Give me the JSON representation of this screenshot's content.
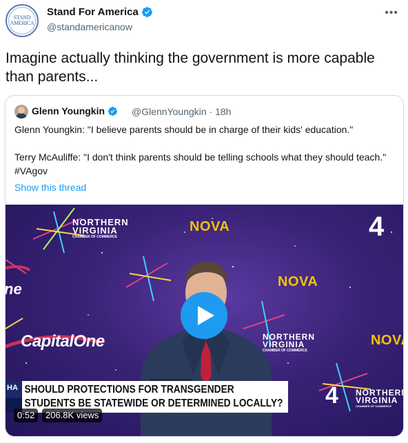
{
  "author": {
    "name": "Stand For America",
    "handle": "@standamericanow",
    "avatar_logo_line1": "STAND",
    "avatar_logo_line2": "AMERICA"
  },
  "more_icon": "more-options-icon",
  "tweet_text": "Imagine actually thinking the government is more capable than parents...",
  "quoted": {
    "name": "Glenn Youngkin",
    "handle_time": "@GlennYoungkin · 18h",
    "line1": "Glenn Youngkin: \"I believe parents should be in charge of their kids' education.\"",
    "line2": "Terry McAuliffe: \"I don't think parents should be telling schools what they should teach.\" #VAgov",
    "show_thread": "Show this thread"
  },
  "video": {
    "logos": {
      "northern_virginia_1": "NORTHERN",
      "northern_virginia_2": "VIRGINIA",
      "chamber": "CHAMBER OF COMMERCE",
      "nova": "NOVA",
      "capital_one": "CapitalOne",
      "one_partial": "ne",
      "nbc_number": "4"
    },
    "lower_third_line1": "SHOULD PROTECTIONS FOR TRANSGENDER",
    "lower_third_line2": "STUDENTS BE STATEWIDE OR DETERMINED LOCALLY?",
    "duration": "0:52",
    "views": "206.8K views"
  },
  "colors": {
    "verified": "#1d9bf0",
    "link": "#1d9bf0",
    "play_button": "#1d9bf0",
    "nova_yellow": "#f1c400"
  }
}
